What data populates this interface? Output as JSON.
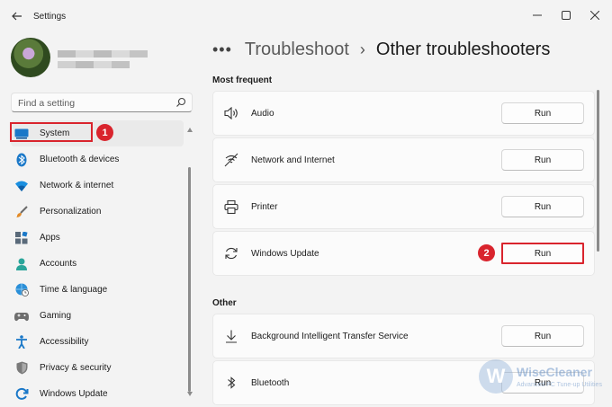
{
  "window": {
    "title": "Settings",
    "controls": [
      "minimize",
      "maximize",
      "close"
    ]
  },
  "search": {
    "placeholder": "Find a setting"
  },
  "sidebar": {
    "items": [
      {
        "label": "System",
        "icon": "system-icon",
        "selected": true
      },
      {
        "label": "Bluetooth & devices",
        "icon": "bluetooth-icon"
      },
      {
        "label": "Network & internet",
        "icon": "wifi-icon"
      },
      {
        "label": "Personalization",
        "icon": "brush-icon"
      },
      {
        "label": "Apps",
        "icon": "apps-icon"
      },
      {
        "label": "Accounts",
        "icon": "person-icon"
      },
      {
        "label": "Time & language",
        "icon": "globe-clock-icon"
      },
      {
        "label": "Gaming",
        "icon": "gamepad-icon"
      },
      {
        "label": "Accessibility",
        "icon": "accessibility-icon"
      },
      {
        "label": "Privacy & security",
        "icon": "shield-icon"
      },
      {
        "label": "Windows Update",
        "icon": "update-icon"
      }
    ]
  },
  "breadcrumb": {
    "more": "•••",
    "parent": "Troubleshoot",
    "separator": "›",
    "current": "Other troubleshooters"
  },
  "sections": {
    "frequent": "Most frequent",
    "other": "Other"
  },
  "troubleshooters": {
    "frequent": [
      {
        "label": "Audio",
        "icon": "speaker-icon",
        "button": "Run"
      },
      {
        "label": "Network and Internet",
        "icon": "network-icon",
        "button": "Run"
      },
      {
        "label": "Printer",
        "icon": "printer-icon",
        "button": "Run"
      },
      {
        "label": "Windows Update",
        "icon": "refresh-icon",
        "button": "Run"
      }
    ],
    "other": [
      {
        "label": "Background Intelligent Transfer Service",
        "icon": "download-icon",
        "button": "Run"
      },
      {
        "label": "Bluetooth",
        "icon": "bluetooth-icon",
        "button": "Run"
      }
    ]
  },
  "annotations": {
    "step1": "1",
    "step2": "2",
    "highlight_color": "#d9242d"
  },
  "watermark": {
    "letter": "W",
    "title": "WiseCleaner",
    "subtitle": "Advanced PC Tune-up Utilities"
  }
}
